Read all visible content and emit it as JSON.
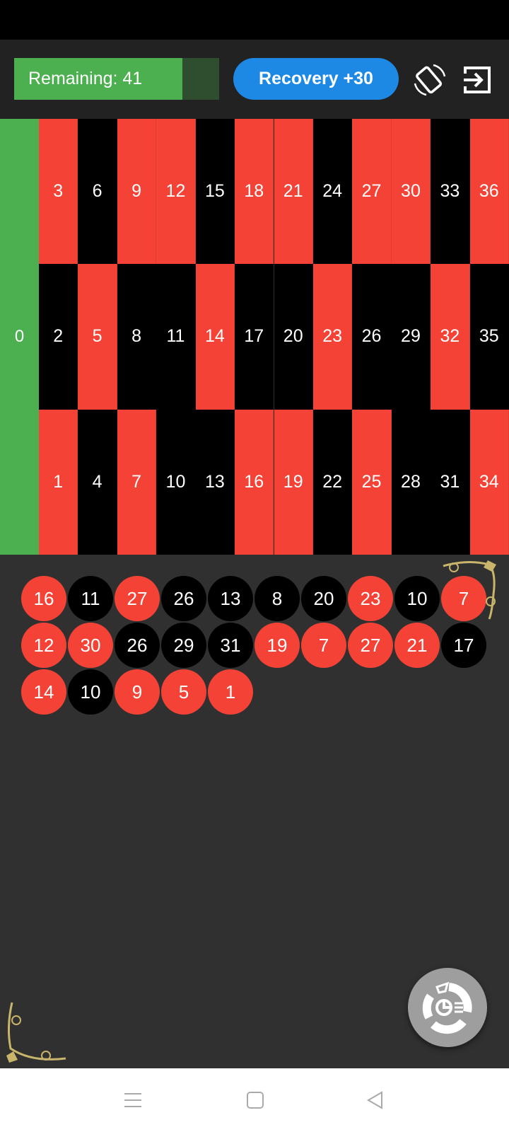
{
  "header": {
    "remaining_label": "Remaining: 41",
    "remaining_fraction": 0.82,
    "recovery_label": "Recovery +30",
    "rotate_icon": "screen-rotation-icon",
    "exit_icon": "exit-icon"
  },
  "colors": {
    "red": "#f44336",
    "black": "#000000",
    "green": "#4caf50",
    "accent": "#1e88e5"
  },
  "table": {
    "zero": "0",
    "rows": [
      [
        {
          "n": "3",
          "c": "red"
        },
        {
          "n": "6",
          "c": "black"
        },
        {
          "n": "9",
          "c": "red"
        },
        {
          "n": "12",
          "c": "red"
        },
        {
          "n": "15",
          "c": "black"
        },
        {
          "n": "18",
          "c": "red"
        },
        {
          "n": "21",
          "c": "red"
        },
        {
          "n": "24",
          "c": "black"
        },
        {
          "n": "27",
          "c": "red"
        },
        {
          "n": "30",
          "c": "red"
        },
        {
          "n": "33",
          "c": "black"
        },
        {
          "n": "36",
          "c": "red"
        }
      ],
      [
        {
          "n": "2",
          "c": "black"
        },
        {
          "n": "5",
          "c": "red"
        },
        {
          "n": "8",
          "c": "black"
        },
        {
          "n": "11",
          "c": "black"
        },
        {
          "n": "14",
          "c": "red"
        },
        {
          "n": "17",
          "c": "black"
        },
        {
          "n": "20",
          "c": "black"
        },
        {
          "n": "23",
          "c": "red"
        },
        {
          "n": "26",
          "c": "black"
        },
        {
          "n": "29",
          "c": "black"
        },
        {
          "n": "32",
          "c": "red"
        },
        {
          "n": "35",
          "c": "black"
        }
      ],
      [
        {
          "n": "1",
          "c": "red"
        },
        {
          "n": "4",
          "c": "black"
        },
        {
          "n": "7",
          "c": "red"
        },
        {
          "n": "10",
          "c": "black"
        },
        {
          "n": "13",
          "c": "black"
        },
        {
          "n": "16",
          "c": "red"
        },
        {
          "n": "19",
          "c": "red"
        },
        {
          "n": "22",
          "c": "black"
        },
        {
          "n": "25",
          "c": "red"
        },
        {
          "n": "28",
          "c": "black"
        },
        {
          "n": "31",
          "c": "black"
        },
        {
          "n": "34",
          "c": "red"
        }
      ]
    ]
  },
  "history": [
    {
      "n": "16",
      "c": "red"
    },
    {
      "n": "11",
      "c": "black"
    },
    {
      "n": "27",
      "c": "red"
    },
    {
      "n": "26",
      "c": "black"
    },
    {
      "n": "13",
      "c": "black"
    },
    {
      "n": "8",
      "c": "black"
    },
    {
      "n": "20",
      "c": "black"
    },
    {
      "n": "23",
      "c": "red"
    },
    {
      "n": "10",
      "c": "black"
    },
    {
      "n": "7",
      "c": "red"
    },
    {
      "n": "12",
      "c": "red"
    },
    {
      "n": "30",
      "c": "red"
    },
    {
      "n": "26",
      "c": "black"
    },
    {
      "n": "29",
      "c": "black"
    },
    {
      "n": "31",
      "c": "black"
    },
    {
      "n": "19",
      "c": "red"
    },
    {
      "n": "7",
      "c": "red"
    },
    {
      "n": "27",
      "c": "red"
    },
    {
      "n": "21",
      "c": "red"
    },
    {
      "n": "17",
      "c": "black"
    },
    {
      "n": "14",
      "c": "red"
    },
    {
      "n": "10",
      "c": "black"
    },
    {
      "n": "9",
      "c": "red"
    },
    {
      "n": "5",
      "c": "red"
    },
    {
      "n": "1",
      "c": "red"
    }
  ],
  "fab": {
    "icon": "statistics-icon"
  },
  "nav": {
    "icons": [
      "menu-icon",
      "home-icon",
      "back-icon"
    ]
  }
}
